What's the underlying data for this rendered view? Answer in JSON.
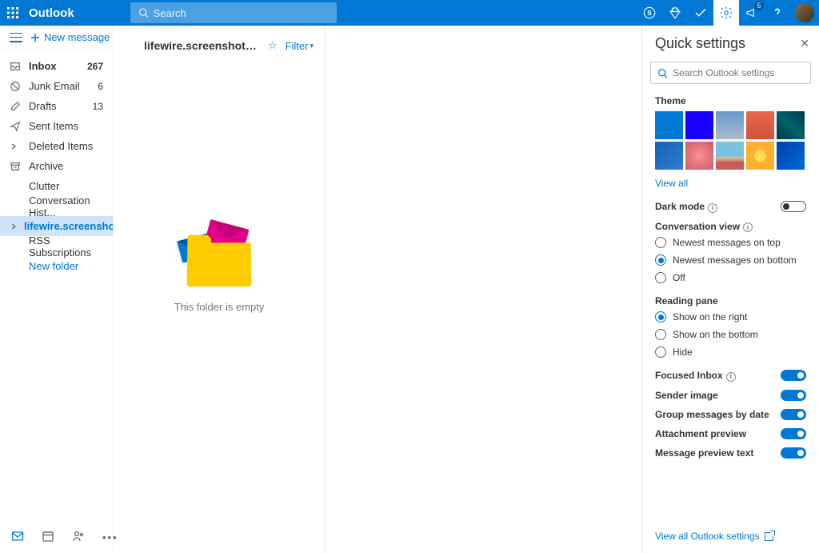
{
  "header": {
    "app_title": "Outlook",
    "search_placeholder": "Search",
    "megaphone_badge": "5"
  },
  "sidebar": {
    "new_message": "New message",
    "folders": [
      {
        "icon": "inbox",
        "label": "Inbox",
        "count": "267",
        "bold": true
      },
      {
        "icon": "junk",
        "label": "Junk Email",
        "count": "6"
      },
      {
        "icon": "drafts",
        "label": "Drafts",
        "count": "13"
      },
      {
        "icon": "sent",
        "label": "Sent Items"
      },
      {
        "icon": "chevron",
        "label": "Deleted Items"
      },
      {
        "icon": "archive",
        "label": "Archive"
      },
      {
        "indent": true,
        "label": "Clutter"
      },
      {
        "indent": true,
        "label": "Conversation Hist..."
      },
      {
        "icon": "chevron",
        "label": "lifewire.screensho...",
        "selected": true
      },
      {
        "indent": true,
        "label": "RSS Subscriptions"
      },
      {
        "indent": true,
        "label": "New folder",
        "link": true
      }
    ]
  },
  "content": {
    "folder_name": "lifewire.screenshot@gm...",
    "filter_label": "Filter",
    "empty": "This folder is empty"
  },
  "panel": {
    "title": "Quick settings",
    "search_placeholder": "Search Outlook settings",
    "theme_label": "Theme",
    "themes": [
      {
        "bg": "#0078d4",
        "sel": true
      },
      {
        "bg": "#1a00ff"
      },
      {
        "bg": "linear-gradient(180deg,#6699cc,#aabbcc)"
      },
      {
        "bg": "linear-gradient(180deg,#e86850,#d0503c)"
      },
      {
        "bg": "linear-gradient(45deg,#003844,#00626e,#003844)"
      },
      {
        "bg": "linear-gradient(135deg,#1a5fb4,#2a7fd4)"
      },
      {
        "bg": "radial-gradient(circle,#ff9090,#c85a6e)"
      },
      {
        "bg": "linear-gradient(180deg,#7ac2e0 55%,#e0d090 55%,#c85a5a 75%)"
      },
      {
        "bg": "radial-gradient(circle,#ffdd55 30%,#ffb030 30%)"
      },
      {
        "bg": "linear-gradient(135deg,#0044aa,#0066dd)"
      }
    ],
    "view_all": "View all",
    "dark_mode": "Dark mode",
    "conversation_view": "Conversation view",
    "conv_options": [
      {
        "label": "Newest messages on top"
      },
      {
        "label": "Newest messages on bottom",
        "sel": true
      },
      {
        "label": "Off"
      }
    ],
    "reading_pane": "Reading pane",
    "pane_options": [
      {
        "label": "Show on the right",
        "sel": true
      },
      {
        "label": "Show on the bottom"
      },
      {
        "label": "Hide"
      }
    ],
    "toggles": [
      {
        "label": "Focused Inbox",
        "on": true,
        "info": true
      },
      {
        "label": "Sender image",
        "on": true
      },
      {
        "label": "Group messages by date",
        "on": true
      },
      {
        "label": "Attachment preview",
        "on": true
      },
      {
        "label": "Message preview text",
        "on": true
      }
    ],
    "view_all_settings": "View all Outlook settings"
  }
}
